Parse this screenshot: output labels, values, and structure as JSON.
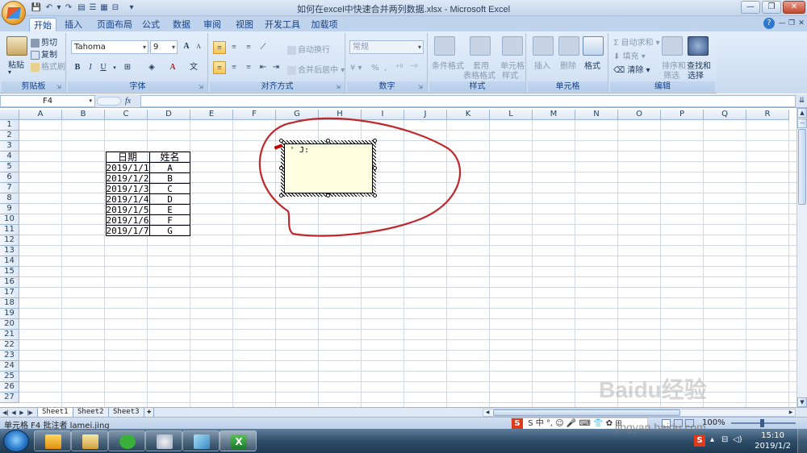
{
  "window": {
    "title": "如何在excel中快速合并两列数据.xlsx - Microsoft Excel",
    "qa_save": "💾",
    "qa_undo": "↶",
    "qa_redo": "↷",
    "qa_more": "▾",
    "min": "—",
    "max": "❐",
    "close": "✕"
  },
  "tabs": [
    {
      "label": "开始"
    },
    {
      "label": "插入"
    },
    {
      "label": "页面布局"
    },
    {
      "label": "公式"
    },
    {
      "label": "数据"
    },
    {
      "label": "审阅"
    },
    {
      "label": "视图"
    },
    {
      "label": "开发工具"
    },
    {
      "label": "加载项"
    }
  ],
  "ribbon": {
    "clipboard": {
      "label": "剪贴板",
      "paste": "粘贴",
      "cut": "剪切",
      "copy": "复制",
      "format_painter": "格式刷"
    },
    "font": {
      "label": "字体",
      "font_name": "Tahoma",
      "font_size": "9",
      "grow": "A",
      "shrink": "A",
      "bold": "B",
      "italic": "I",
      "underline": "U"
    },
    "alignment": {
      "label": "对齐方式",
      "wrap_text": "自动换行",
      "merge_center": "合并后居中"
    },
    "number": {
      "label": "数字",
      "format": "常规",
      "percent": "%",
      "comma": ","
    },
    "styles": {
      "label": "样式",
      "conditional": "条件格式",
      "table_format_1": "套用",
      "table_format_2": "表格格式",
      "cell_styles_1": "单元格",
      "cell_styles_2": "样式"
    },
    "cells": {
      "label": "单元格",
      "insert": "插入",
      "delete": "删除",
      "format": "格式"
    },
    "editing": {
      "label": "编辑",
      "autosum": "自动求和",
      "fill": "填充",
      "clear": "清除",
      "sort_1": "排序和",
      "sort_2": "筛选",
      "find_1": "查找和",
      "find_2": "选择"
    }
  },
  "formula_bar": {
    "name_box": "F4",
    "fx": "fx",
    "value": ""
  },
  "grid": {
    "columns": [
      "A",
      "B",
      "C",
      "D",
      "E",
      "F",
      "G",
      "H",
      "I",
      "J",
      "K",
      "L",
      "M",
      "N",
      "O",
      "P",
      "Q",
      "R"
    ],
    "rows": [
      "1",
      "2",
      "3",
      "4",
      "5",
      "6",
      "7",
      "8",
      "9",
      "10",
      "11",
      "12",
      "13",
      "14",
      "15",
      "16",
      "17",
      "18",
      "19",
      "20",
      "21",
      "22",
      "23",
      "24",
      "25",
      "26",
      "27"
    ],
    "table": {
      "header": [
        "日期",
        "姓名"
      ],
      "rows": [
        [
          "2019/1/1",
          "A"
        ],
        [
          "2019/1/2",
          "B"
        ],
        [
          "2019/1/3",
          "C"
        ],
        [
          "2019/1/4",
          "D"
        ],
        [
          "2019/1/5",
          "E"
        ],
        [
          "2019/1/6",
          "F"
        ],
        [
          "2019/1/7",
          "G"
        ]
      ]
    },
    "comment_text": "' J:"
  },
  "sheets": [
    {
      "label": "Sheet1"
    },
    {
      "label": "Sheet2"
    },
    {
      "label": "Sheet3"
    }
  ],
  "status": {
    "text": "单元格 F4 批注者 lamei.jing",
    "ime": "S 中 °, ☺ 🎤 ⌨ 👕 ✿ ⊞",
    "zoom": "100%"
  },
  "taskbar": {
    "time": "15:10",
    "date": "2019/1/2"
  },
  "watermark": {
    "brand": "Baidu经验",
    "url": "jingyan.baidu.com"
  },
  "colors": {
    "annotation_circle": "#c0282c",
    "comment_fill": "#ffffe1",
    "ribbon_bg": "#d6e4f5"
  }
}
